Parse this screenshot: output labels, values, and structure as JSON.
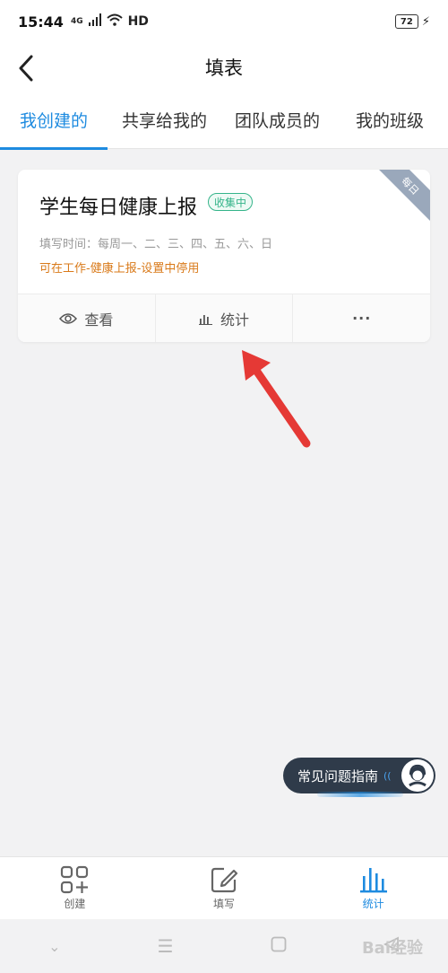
{
  "status_bar": {
    "time": "15:44",
    "network": "4G",
    "hd": "HD",
    "battery": "72"
  },
  "header": {
    "title": "填表"
  },
  "tabs": [
    {
      "label": "我创建的",
      "active": true
    },
    {
      "label": "共享给我的",
      "active": false
    },
    {
      "label": "团队成员的",
      "active": false
    },
    {
      "label": "我的班级",
      "active": false
    }
  ],
  "card": {
    "ribbon": "每日",
    "title": "学生每日健康上报",
    "badge": "收集中",
    "fill_time": "填写时间：每周一、二、三、四、五、六、日",
    "stop_note": "可在工作-健康上报-设置中停用",
    "actions": {
      "view": "查看",
      "stats": "统计",
      "more": "···"
    }
  },
  "faq": {
    "label": "常见问题指南"
  },
  "bottom_nav": [
    {
      "label": "创建",
      "icon": "grid-plus-icon",
      "active": false
    },
    {
      "label": "填写",
      "icon": "edit-icon",
      "active": false
    },
    {
      "label": "统计",
      "icon": "bar-chart-icon",
      "active": true
    }
  ],
  "watermark": "Bai经验",
  "colors": {
    "accent": "#1e8be0",
    "badge_green": "#35b48a",
    "note_orange": "#d97a1a",
    "arrow_red": "#e53935"
  }
}
